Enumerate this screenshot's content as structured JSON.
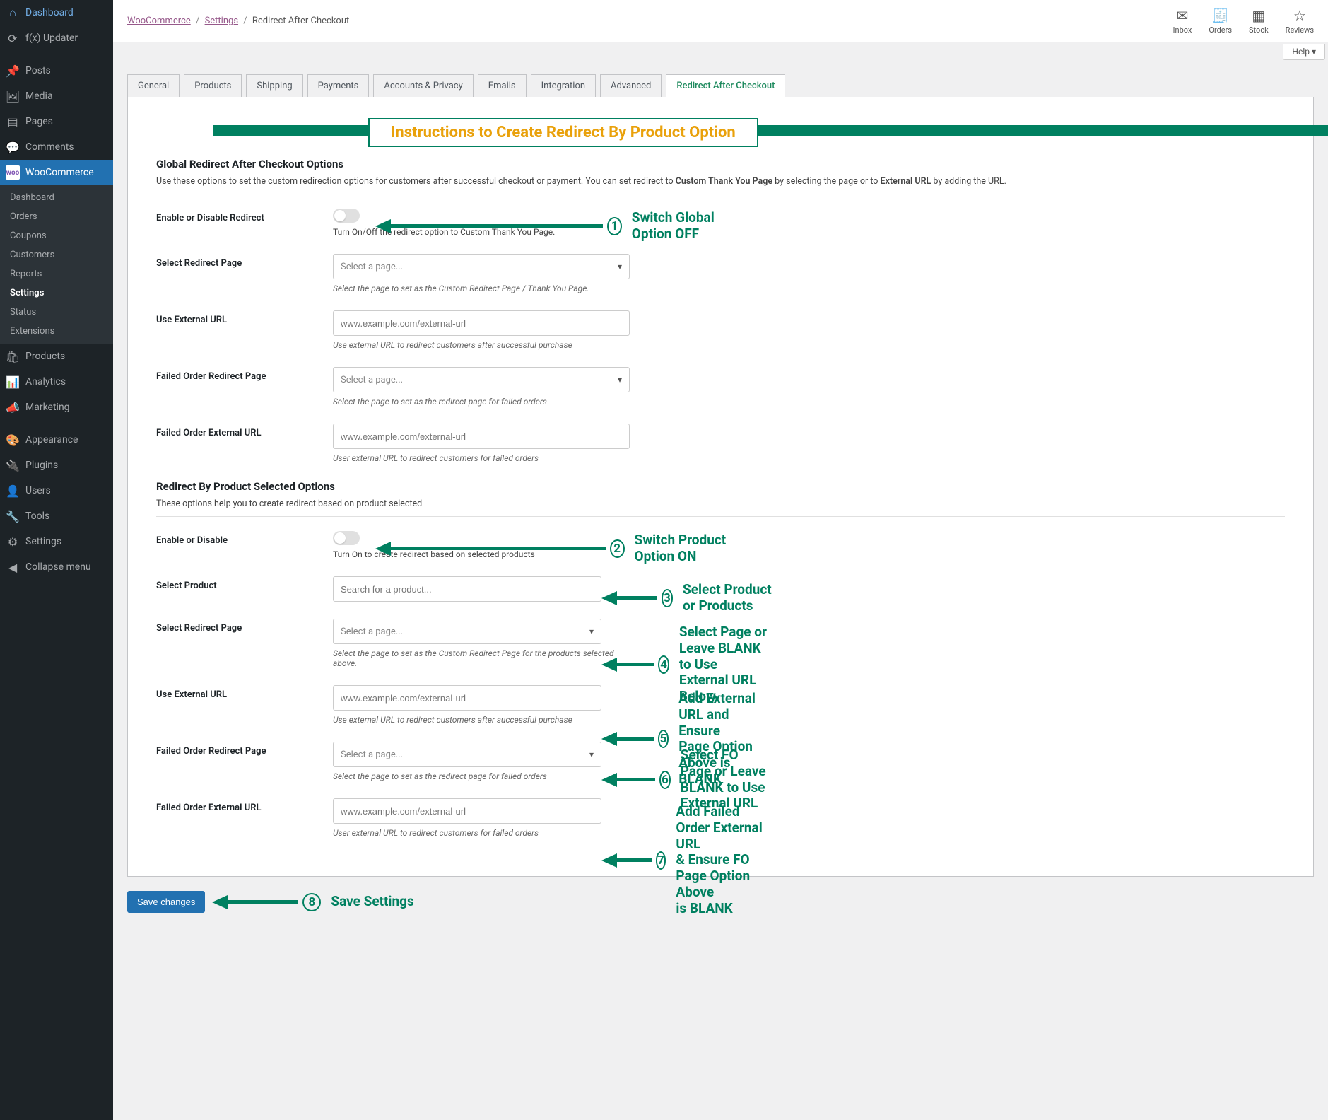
{
  "sidebar": {
    "items": [
      {
        "icon": "⌂",
        "label": "Dashboard"
      },
      {
        "icon": "⟳",
        "label": "f(x) Updater"
      },
      {
        "icon": "✎",
        "label": "Posts"
      },
      {
        "icon": "🖼",
        "label": "Media"
      },
      {
        "icon": "▤",
        "label": "Pages"
      },
      {
        "icon": "💬",
        "label": "Comments"
      },
      {
        "icon": "W",
        "label": "WooCommerce"
      },
      {
        "icon": "🛍",
        "label": "Products"
      },
      {
        "icon": "📊",
        "label": "Analytics"
      },
      {
        "icon": "📣",
        "label": "Marketing"
      },
      {
        "icon": "🎨",
        "label": "Appearance"
      },
      {
        "icon": "🔌",
        "label": "Plugins"
      },
      {
        "icon": "👤",
        "label": "Users"
      },
      {
        "icon": "🔧",
        "label": "Tools"
      },
      {
        "icon": "⚙",
        "label": "Settings"
      },
      {
        "icon": "◀",
        "label": "Collapse menu"
      }
    ],
    "sub": [
      "Dashboard",
      "Orders",
      "Coupons",
      "Customers",
      "Reports",
      "Settings",
      "Status",
      "Extensions"
    ],
    "sub_active": "Settings"
  },
  "breadcrumb": {
    "l1": "WooCommerce",
    "l2": "Settings",
    "l3": "Redirect After Checkout"
  },
  "top_icons": [
    {
      "glyph": "✉",
      "label": "Inbox"
    },
    {
      "glyph": "🧾",
      "label": "Orders"
    },
    {
      "glyph": "▦",
      "label": "Stock"
    },
    {
      "glyph": "☆",
      "label": "Reviews"
    }
  ],
  "help_label": "Help ▾",
  "tabs": [
    "General",
    "Products",
    "Shipping",
    "Payments",
    "Accounts & Privacy",
    "Emails",
    "Integration",
    "Advanced",
    "Redirect After Checkout"
  ],
  "active_tab": "Redirect After Checkout",
  "inst_banner": "Instructions to Create  Redirect By Product Option",
  "global": {
    "title": "Global Redirect After Checkout Options",
    "desc_a": "Use these options to set the custom redirection options for customers after successful checkout or payment. You can set redirect to ",
    "desc_b": "Custom Thank You Page",
    "desc_c": " by selecting the page or to ",
    "desc_d": "External URL",
    "desc_e": " by adding the URL.",
    "rows": {
      "enable_label": "Enable or Disable Redirect",
      "enable_help": "Turn On/Off the redirect option to Custom Thank You Page.",
      "select_page_label": "Select Redirect Page",
      "select_page_placeholder": "Select a page...",
      "select_page_help": "Select the page to set as the Custom Redirect Page / Thank You Page.",
      "ext_url_label": "Use External URL",
      "ext_url_placeholder": "www.example.com/external-url",
      "ext_url_help": "Use external URL to redirect customers after successful purchase",
      "fo_page_label": "Failed Order Redirect Page",
      "fo_page_placeholder": "Select a page...",
      "fo_page_help": "Select the page to set as the redirect page for failed orders",
      "fo_url_label": "Failed Order External URL",
      "fo_url_placeholder": "www.example.com/external-url",
      "fo_url_help": "User external URL to redirect customers for failed orders"
    }
  },
  "product": {
    "title": "Redirect By Product Selected Options",
    "desc": "These options help you to create redirect based on product selected",
    "rows": {
      "enable_label": "Enable or Disable",
      "enable_help": "Turn On to create redirect based on selected products",
      "select_product_label": "Select Product",
      "select_product_placeholder": "Search for a product...",
      "select_page_label": "Select Redirect Page",
      "select_page_placeholder": "Select a page...",
      "select_page_help": "Select the page to set as the Custom Redirect Page for the products selected above.",
      "ext_url_label": "Use External URL",
      "ext_url_placeholder": "www.example.com/external-url",
      "ext_url_help": "Use external URL to redirect customers after successful purchase",
      "fo_page_label": "Failed Order Redirect Page",
      "fo_page_placeholder": "Select a page...",
      "fo_page_help": "Select the page to set as the redirect page for failed orders",
      "fo_url_label": "Failed Order External URL",
      "fo_url_placeholder": "www.example.com/external-url",
      "fo_url_help": "User external URL to redirect customers for failed orders"
    }
  },
  "annot": {
    "a1": "Switch Global Option OFF",
    "a2": "Switch Product Option ON",
    "a3": "Select Product or Products",
    "a4a": "Select Page or Leave BLANK",
    "a4b": "to Use External URL Below",
    "a5a": "Add External URL and Ensure",
    "a5b": "Page Option Above is BLANK",
    "a6a": "Select FO Page or Leave",
    "a6b": "BLANK to Use External URL",
    "a7a": "Add Failed Order External URL",
    "a7b": "& Ensure FO Page Option Above",
    "a7c": "is BLANK",
    "a8": "Save Settings"
  },
  "save_btn": "Save changes"
}
